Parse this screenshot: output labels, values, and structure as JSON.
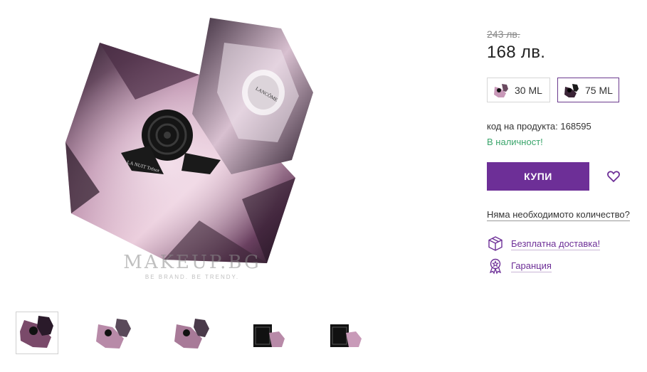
{
  "product": {
    "old_price": "243 лв.",
    "new_price": "168 лв.",
    "variants": [
      {
        "label": "30 ML",
        "selected": false
      },
      {
        "label": "75 ML",
        "selected": true
      }
    ],
    "code_line": "код на продукта: 168595",
    "stock": "В наличност!",
    "buy_label": "КУПИ",
    "quantity_link": "Няма необходимото количество?",
    "delivery_label": "Безплатна доставка!",
    "guarantee_label": "Гаранция"
  },
  "gallery": {
    "watermark_brand": "MAKEUP.BG",
    "watermark_tagline": "BE BRAND. BE TRENDY.",
    "bottle_label_brand": "LANCÔME",
    "bottle_label_name": "LA NUIT Trésor",
    "thumbnail_count": 5
  },
  "colors": {
    "accent": "#6d2f97",
    "in_stock": "#3aa56b",
    "variant_selected_border": "#6b3a8e"
  }
}
